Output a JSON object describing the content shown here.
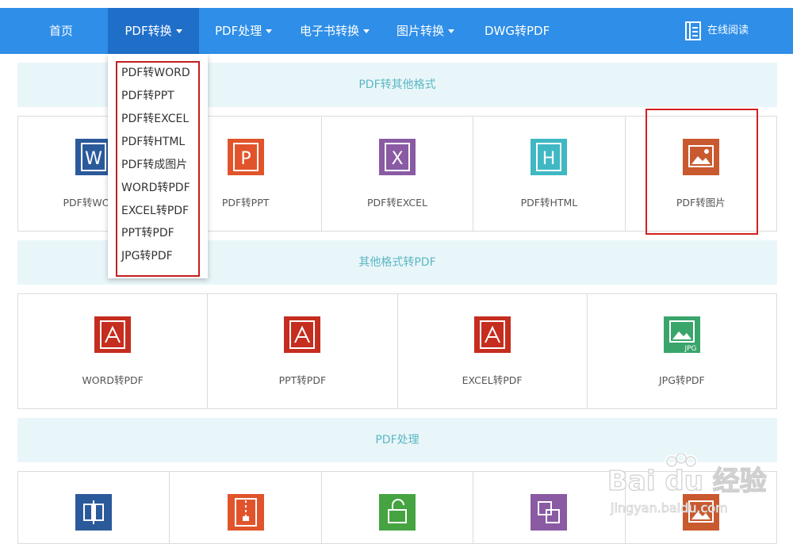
{
  "nav": {
    "items": [
      {
        "label": "首页"
      },
      {
        "label": "PDF转换"
      },
      {
        "label": "PDF处理"
      },
      {
        "label": "电子书转换"
      },
      {
        "label": "图片转换"
      },
      {
        "label": "DWG转PDF"
      }
    ],
    "reader_label": "在线阅读"
  },
  "dropdown": {
    "items": [
      "PDF转WORD",
      "PDF转PPT",
      "PDF转EXCEL",
      "PDF转HTML",
      "PDF转成图片",
      "WORD转PDF",
      "EXCEL转PDF",
      "PPT转PDF",
      "JPG转PDF"
    ]
  },
  "section1": {
    "title": "PDF转其他格式",
    "items": [
      {
        "label": "PDF转WORD",
        "icon": "word-icon",
        "color": "#2b5a9b"
      },
      {
        "label": "PDF转PPT",
        "icon": "ppt-icon",
        "color": "#e1542b"
      },
      {
        "label": "PDF转EXCEL",
        "icon": "excel-icon",
        "color": "#8a5aa3"
      },
      {
        "label": "PDF转HTML",
        "icon": "html-icon",
        "color": "#3fb8c4"
      },
      {
        "label": "PDF转图片",
        "icon": "image-icon",
        "color": "#c9592e"
      }
    ]
  },
  "section2": {
    "title": "其他格式转PDF",
    "items": [
      {
        "label": "WORD转PDF",
        "icon": "pdf-icon",
        "color": "#c52d1f"
      },
      {
        "label": "PPT转PDF",
        "icon": "pdf-icon",
        "color": "#c52d1f"
      },
      {
        "label": "EXCEL转PDF",
        "icon": "pdf-icon",
        "color": "#c52d1f"
      },
      {
        "label": "JPG转PDF",
        "icon": "jpg-icon",
        "color": "#3aa56b"
      }
    ]
  },
  "section3": {
    "title": "PDF处理"
  },
  "watermark": {
    "brand_text": "Bai du 经验",
    "url": "jingyan.baidu.com"
  },
  "colors": {
    "nav_bg": "#2e8ee8",
    "nav_active": "#1f6fc9",
    "section_bg": "#e9f6f9",
    "section_text": "#5ab7c4",
    "highlight": "#d32121"
  }
}
